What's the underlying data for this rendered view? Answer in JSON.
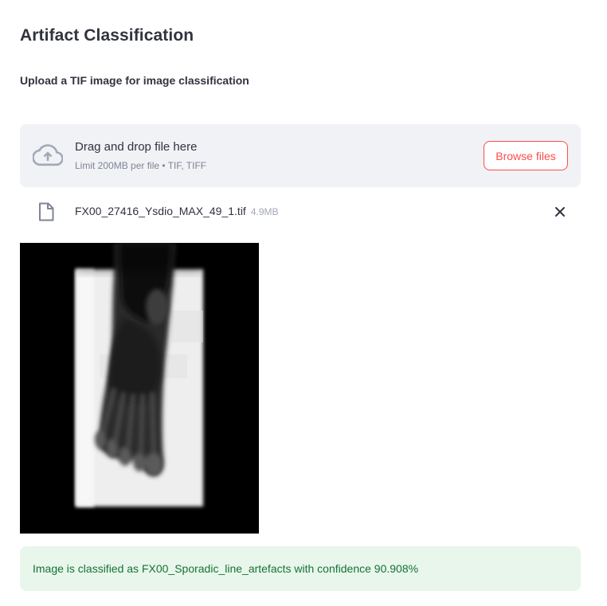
{
  "app": {
    "title": "Artifact Classification",
    "subtitle": "Upload a TIF image for image classification"
  },
  "uploader": {
    "instructions": "Drag and drop file here",
    "limit_text": "Limit 200MB per file • TIF, TIFF",
    "browse_label": "Browse files",
    "icon": "cloud-upload-icon"
  },
  "uploaded_file": {
    "name": "FX00_27416_Ysdio_MAX_49_1.tif",
    "size": "4.9MB",
    "icon": "file-icon",
    "remove_icon": "close-icon"
  },
  "preview": {
    "description_icon": "xray-foot-image"
  },
  "result": {
    "text": "Image is classified as FX00_Sporadic_line_artefacts with confidence 90.908%"
  },
  "colors": {
    "accent": "#ff4b4b",
    "dropzone_bg": "#f0f2f6",
    "success_bg": "#e8f6ec",
    "success_text": "#177233",
    "text": "#31333f"
  }
}
